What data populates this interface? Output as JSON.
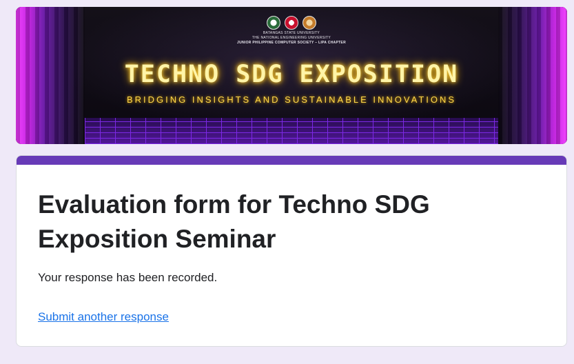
{
  "banner": {
    "university_line1": "BATANGAS STATE UNIVERSITY",
    "university_line2": "THE NATIONAL ENGINEERING UNIVERSITY",
    "university_line3": "JUNIOR PHILIPPINE COMPUTER SOCIETY – LIPA CHAPTER",
    "title": "TECHNO SDG EXPOSITION",
    "subtitle": "BRIDGING INSIGHTS AND SUSTAINABLE INNOVATIONS",
    "logos": [
      "university-seal-icon",
      "university-shield-icon",
      "society-logo-icon"
    ]
  },
  "form": {
    "title": "Evaluation form for Techno SDG Exposition Seminar",
    "confirmation": "Your response has been recorded.",
    "submit_another_label": "Submit another response"
  },
  "colors": {
    "accent": "#673ab7",
    "link": "#1a73e8",
    "page_bg": "#efe9f8"
  }
}
